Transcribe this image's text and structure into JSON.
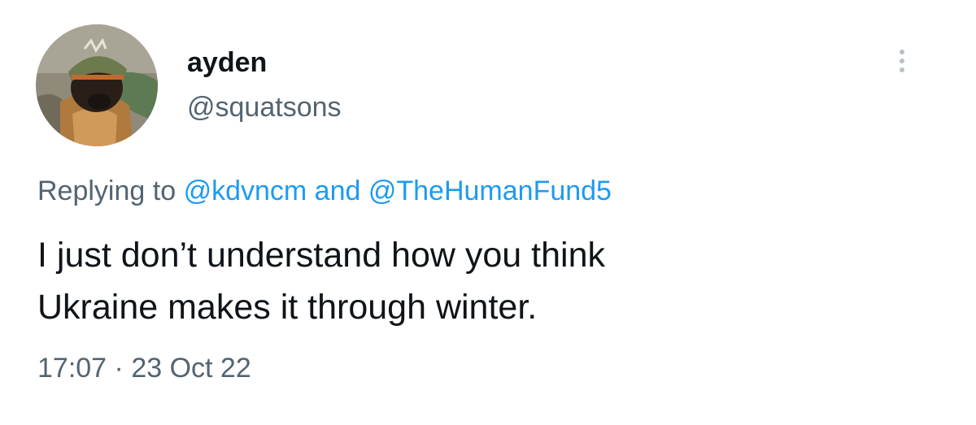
{
  "user": {
    "display_name": "ayden",
    "handle": "@squatsons"
  },
  "reply": {
    "prefix": "Replying to",
    "mentions": [
      "@kdvncm",
      "@TheHumanFund5"
    ],
    "joiner": "and"
  },
  "tweet": {
    "lines": [
      "I just don’t understand how you think",
      "Ukraine makes it through winter."
    ]
  },
  "meta": {
    "time": "17:07",
    "separator": "·",
    "date": "23 Oct 22"
  },
  "colors": {
    "text": "#0f1419",
    "secondary": "#536471",
    "link": "#1d9bf0"
  },
  "icons": {
    "more": "more-vertical-icon"
  }
}
